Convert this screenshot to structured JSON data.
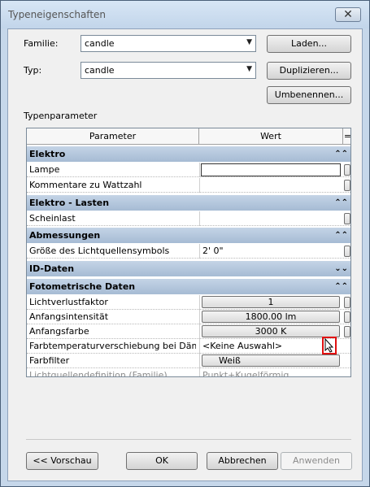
{
  "window": {
    "title": "Typeneigenschaften",
    "close_glyph": "✕"
  },
  "family": {
    "label": "Familie:",
    "value": "candle"
  },
  "type": {
    "label": "Typ:",
    "value": "candle"
  },
  "buttons": {
    "load": "Laden...",
    "duplicate": "Duplizieren...",
    "rename": "Umbenennen..."
  },
  "section_label": "Typenparameter",
  "grid": {
    "col_param": "Parameter",
    "col_value": "Wert",
    "col_eq": "=",
    "groups": [
      {
        "name": "Elektro",
        "chevron": "⌃⌃"
      },
      {
        "name": "Elektro - Lasten",
        "chevron": "⌃⌃"
      },
      {
        "name": "Abmessungen",
        "chevron": "⌃⌃"
      },
      {
        "name": "ID-Daten",
        "chevron": "⌄⌄"
      },
      {
        "name": "Fotometrische Daten",
        "chevron": "⌃⌃"
      }
    ],
    "rows": [
      {
        "param": "Lampe",
        "value": ""
      },
      {
        "param": "Kommentare zu Wattzahl",
        "value": ""
      },
      {
        "param": "Scheinlast",
        "value": ""
      },
      {
        "param": "Größe des Lichtquellensymbols",
        "value": "2'  0\""
      },
      {
        "param": "Lichtverlustfaktor",
        "value": "1"
      },
      {
        "param": "Anfangsintensität",
        "value": "1800.00 lm"
      },
      {
        "param": "Anfangsfarbe",
        "value": "3000 K"
      },
      {
        "param": "Farbtemperaturverschiebung bei Dämp",
        "value": "<Keine Auswahl>"
      },
      {
        "param": "Farbfilter",
        "value": "Weiß"
      },
      {
        "param": "Lichtquellendefinition (Familie)",
        "value": "Punkt+Kugelförmig"
      }
    ]
  },
  "footer": {
    "preview": "<< Vorschau",
    "ok": "OK",
    "cancel": "Abbrechen",
    "apply": "Anwenden"
  }
}
